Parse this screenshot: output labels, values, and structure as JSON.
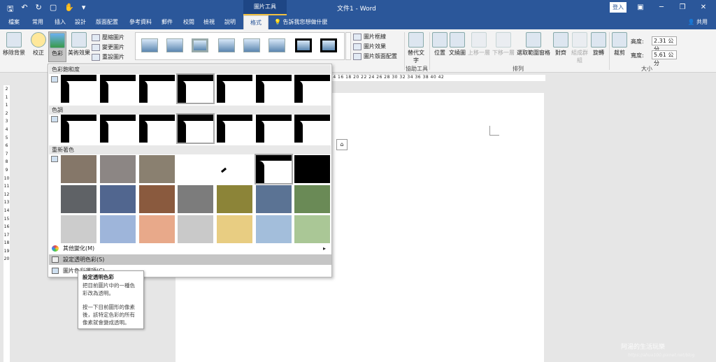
{
  "titlebar": {
    "context_tab": "圖片工具",
    "doc_title": "文件1 - Word",
    "login": "登入",
    "window_buttons": [
      "▣",
      "─",
      "❐",
      "✕"
    ]
  },
  "tabs": [
    "檔案",
    "常用",
    "插入",
    "設計",
    "版面配置",
    "參考資料",
    "郵件",
    "校閱",
    "檢視",
    "說明",
    "格式"
  ],
  "tell_me": "告訴我您想做什麼",
  "share": "共用",
  "ribbon": {
    "remove_bg": "移除背景",
    "correct": "校正",
    "color": "色彩",
    "artistic": "美術效果",
    "compress": "壓縮圖片",
    "change": "變更圖片",
    "reset": "重設圖片",
    "border": "圖片框線",
    "effects": "圖片效果",
    "layout": "圖片版面配置",
    "alt_text": "替代文字",
    "position": "位置",
    "wrap": "文繞圖",
    "forward": "上移一層",
    "backward": "下移一層",
    "selection_pane": "選取範圍窗格",
    "align": "對齊",
    "group": "組成群組",
    "rotate": "旋轉",
    "crop": "裁剪",
    "height_label": "高度:",
    "height_value": "2.31 公分",
    "width_label": "寬度:",
    "width_value": "5.61 公分",
    "group_access": "協助工具",
    "group_arrange": "排列",
    "group_size": "大小"
  },
  "ruler": "14 16 18 20 22 24 26 28 30 32 34 36 38 40 42",
  "vruler": "2 1 1 2 3 4 5 6 7 8 9 10 11 12 13 14 15 16 17 18 19 20",
  "dropdown": {
    "saturation_title": "色彩飽和度",
    "tone_title": "色調",
    "recolor_title": "重新著色",
    "more_variations": "其他變化(M)",
    "set_transparent": "設定透明色彩(S)",
    "picture_color_options": "圖片色彩選項(C)...",
    "recolor_colors": [
      [
        "#857769",
        "#8c8684",
        "#8a8070",
        "#ffffff",
        "#ffffff",
        "#ffffff",
        "#000000"
      ],
      [
        "#5f6266",
        "#51668f",
        "#8a5a3e",
        "#7c7c7c",
        "#8c8438",
        "#5b7394",
        "#6a8a56"
      ],
      [
        "#cccccc",
        "#9eb5da",
        "#e8a98a",
        "#c9c9c9",
        "#e8cd82",
        "#a3bedb",
        "#aac796"
      ]
    ]
  },
  "tooltip": {
    "title": "設定透明色彩",
    "line1": "把目前圖片中的一種色彩改為透明。",
    "line2": "按一下目前圖形的像素後，該特定色彩的所有像素就會變成透明。"
  },
  "watermark": {
    "name": "阿湯的生活玩樂",
    "url": "https://ahua100.pixnet.net/blog"
  }
}
